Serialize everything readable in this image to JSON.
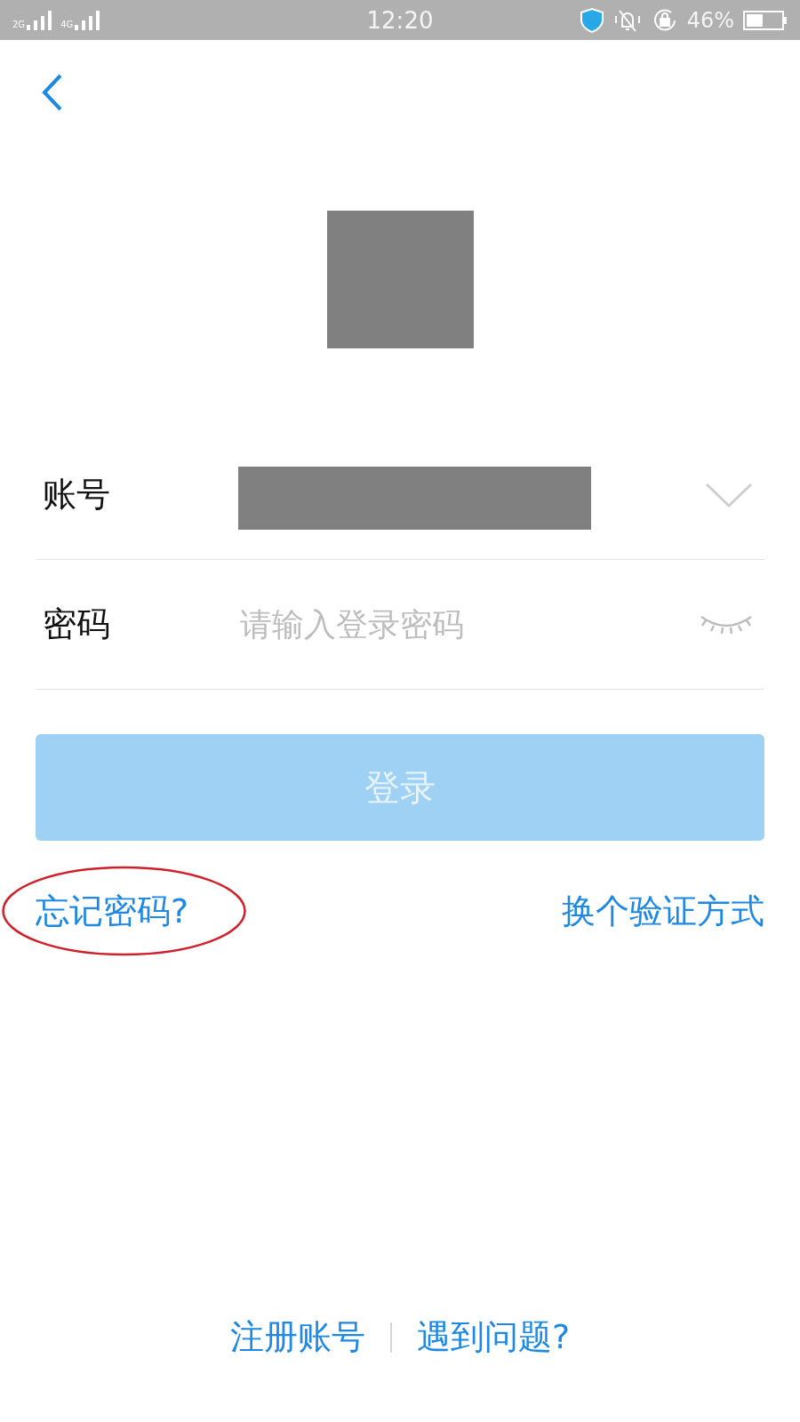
{
  "status_bar": {
    "sim_1": "2G",
    "sim_2": "4G",
    "time": "12:20",
    "battery": "46%"
  },
  "account": {
    "label": "账号",
    "expanded": false
  },
  "password": {
    "label": "密码",
    "placeholder": "请输入登录密码",
    "visible": false
  },
  "login_button": {
    "label": "登录",
    "disabled": true
  },
  "links": [
    {
      "label": "忘记密码?",
      "circled": true
    },
    {
      "label": "换个验证方式",
      "circled": false
    }
  ],
  "footer_links": [
    "注册账号",
    "遇到问题?"
  ]
}
